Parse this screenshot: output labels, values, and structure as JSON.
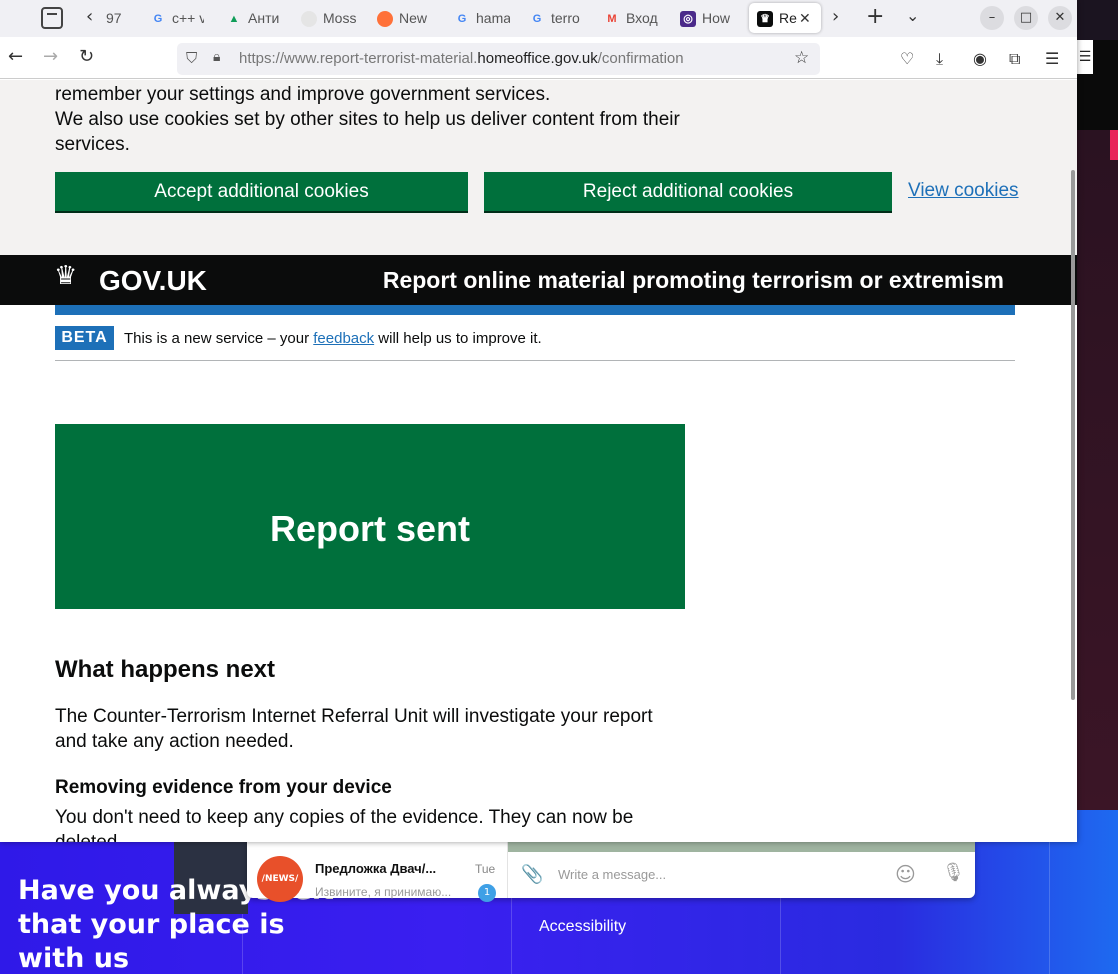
{
  "browser": {
    "tabs": [
      {
        "label": "97",
        "icon": "page"
      },
      {
        "label": "c++ v",
        "icon": "google"
      },
      {
        "label": "Анти",
        "icon": "drive"
      },
      {
        "label": "Moss",
        "icon": "page"
      },
      {
        "label": "New",
        "icon": "firefox"
      },
      {
        "label": "hama",
        "icon": "google"
      },
      {
        "label": "terro",
        "icon": "google"
      },
      {
        "label": "Вход",
        "icon": "gmail"
      },
      {
        "label": "How",
        "icon": "site"
      },
      {
        "label": "Re",
        "icon": "govuk",
        "active": true
      }
    ],
    "url_prefix": "https://www.report-terrorist-material.",
    "url_domain": "homeoffice.gov.uk",
    "url_path": "/confirmation"
  },
  "cookie_banner": {
    "line1": "remember your settings and improve government services.",
    "line2": "We also use cookies set by other sites to help us deliver content from their",
    "line3": "services.",
    "accept_label": "Accept additional cookies",
    "reject_label": "Reject additional cookies",
    "view_label": "View cookies"
  },
  "header": {
    "logo": "GOV.UK",
    "service_name": "Report online material promoting terrorism or extremism"
  },
  "phase_banner": {
    "tag": "BETA",
    "text_before": "This is a new service – your ",
    "link": "feedback",
    "text_after": " will help us to improve it."
  },
  "confirmation": {
    "title": "Report sent"
  },
  "content": {
    "heading": "What happens next",
    "para1": "The Counter-Terrorism Internet Referral Unit will investigate your report and take any action needed.",
    "subheading": "Removing evidence from your device",
    "para2": "You don't need to keep any copies of the evidence. They can now be deleted."
  },
  "background": {
    "promo_headline": "Have you always felt that your place is with us",
    "accessibility": "Accessibility",
    "telegram": {
      "chat_name": "Предложка Двач/...",
      "chat_time": "Tue",
      "chat_preview": "Извините, я принимаю...",
      "unread": "1",
      "avatar_text": "/NEWS/",
      "input_placeholder": "Write a message..."
    }
  },
  "colors": {
    "govuk_green": "#00703c",
    "govuk_blue": "#1d70b8",
    "govuk_black": "#0b0c0c"
  }
}
